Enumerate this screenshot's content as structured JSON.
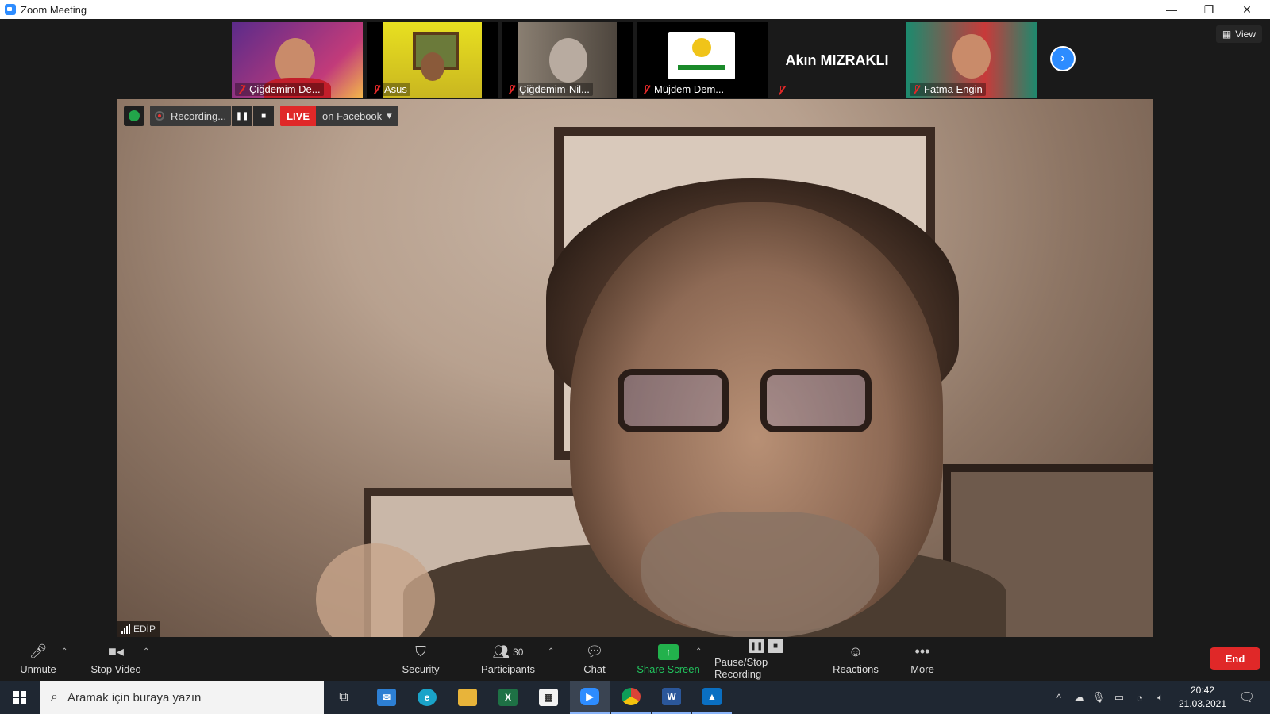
{
  "window": {
    "title": "Zoom Meeting",
    "minimize": "—",
    "restore": "❐",
    "close": "✕"
  },
  "participants_strip": [
    {
      "name": "Çiğdemim De...",
      "bg": "#5b2b8a",
      "muted": true
    },
    {
      "name": "Asus",
      "bg": "#d8c92a",
      "muted": true
    },
    {
      "name": "Çiğdemim-Nil...",
      "bg": "#6a5e52",
      "muted": true
    },
    {
      "name": "Müjdem Dem...",
      "bg": "#f2f2f2",
      "muted": true
    },
    {
      "name": "",
      "big_name": "Akın MIZRAKLI",
      "bg": "#1a1a1a",
      "muted": true
    },
    {
      "name": "Fatma Engin",
      "bg": "#1c8a6e",
      "muted": true
    }
  ],
  "view_button": "View",
  "recording": {
    "label": "Recording...",
    "live_label": "LIVE",
    "platform_label": "on Facebook"
  },
  "active_speaker": "EDİP",
  "toolbar": {
    "unmute": "Unmute",
    "stop_video": "Stop Video",
    "security": "Security",
    "participants": "Participants",
    "participants_count": "30",
    "chat": "Chat",
    "share_screen": "Share Screen",
    "pause_stop_recording": "Pause/Stop Recording",
    "reactions": "Reactions",
    "more": "More",
    "end": "End"
  },
  "taskbar": {
    "search_placeholder": "Aramak için buraya yazın",
    "time": "20:42",
    "date": "21.03.2021"
  },
  "colors": {
    "accent": "#2d8cff",
    "end": "#e02828",
    "share": "#22b14c",
    "live": "#e02828"
  }
}
